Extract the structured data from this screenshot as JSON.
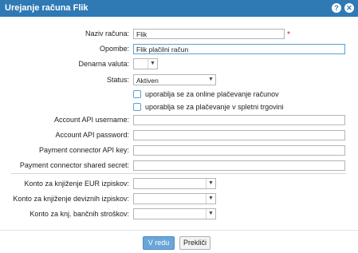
{
  "window": {
    "title": "Urejanje računa Flik",
    "help_icon": "question-icon",
    "close_icon": "close-icon"
  },
  "form": {
    "name": {
      "label": "Naziv računa:",
      "value": "Flik",
      "required_mark": "*"
    },
    "notes": {
      "label": "Opombe:",
      "value": "Flik plačilni račun"
    },
    "currency": {
      "label": "Denarna valuta:",
      "value": ""
    },
    "status": {
      "label": "Status:",
      "value": "Aktiven"
    },
    "online_payments": {
      "label": "uporablja se za online plačevanje računov",
      "checked": false
    },
    "shop_payments": {
      "label": "uporablja se za plačevanje v spletni trgovini",
      "checked": false
    },
    "api_username": {
      "label": "Account API username:",
      "value": ""
    },
    "api_password": {
      "label": "Account API password:",
      "value": ""
    },
    "connector_key": {
      "label": "Payment connector API key:",
      "value": ""
    },
    "connector_secret": {
      "label": "Payment connector shared secret:",
      "value": ""
    },
    "eur_account": {
      "label": "Konto za knjiženje EUR izpiskov:",
      "value": ""
    },
    "foreign_account": {
      "label": "Konto za knjiženje deviznih izpiskov:",
      "value": ""
    },
    "bank_fees_account": {
      "label": "Konto za knj. bančnih stroškov:",
      "value": ""
    }
  },
  "buttons": {
    "ok": "V redu",
    "cancel": "Prekliči"
  },
  "colors": {
    "titlebar": "#2f79b4",
    "primary_button": "#6aa6da",
    "required": "#dd1111"
  }
}
